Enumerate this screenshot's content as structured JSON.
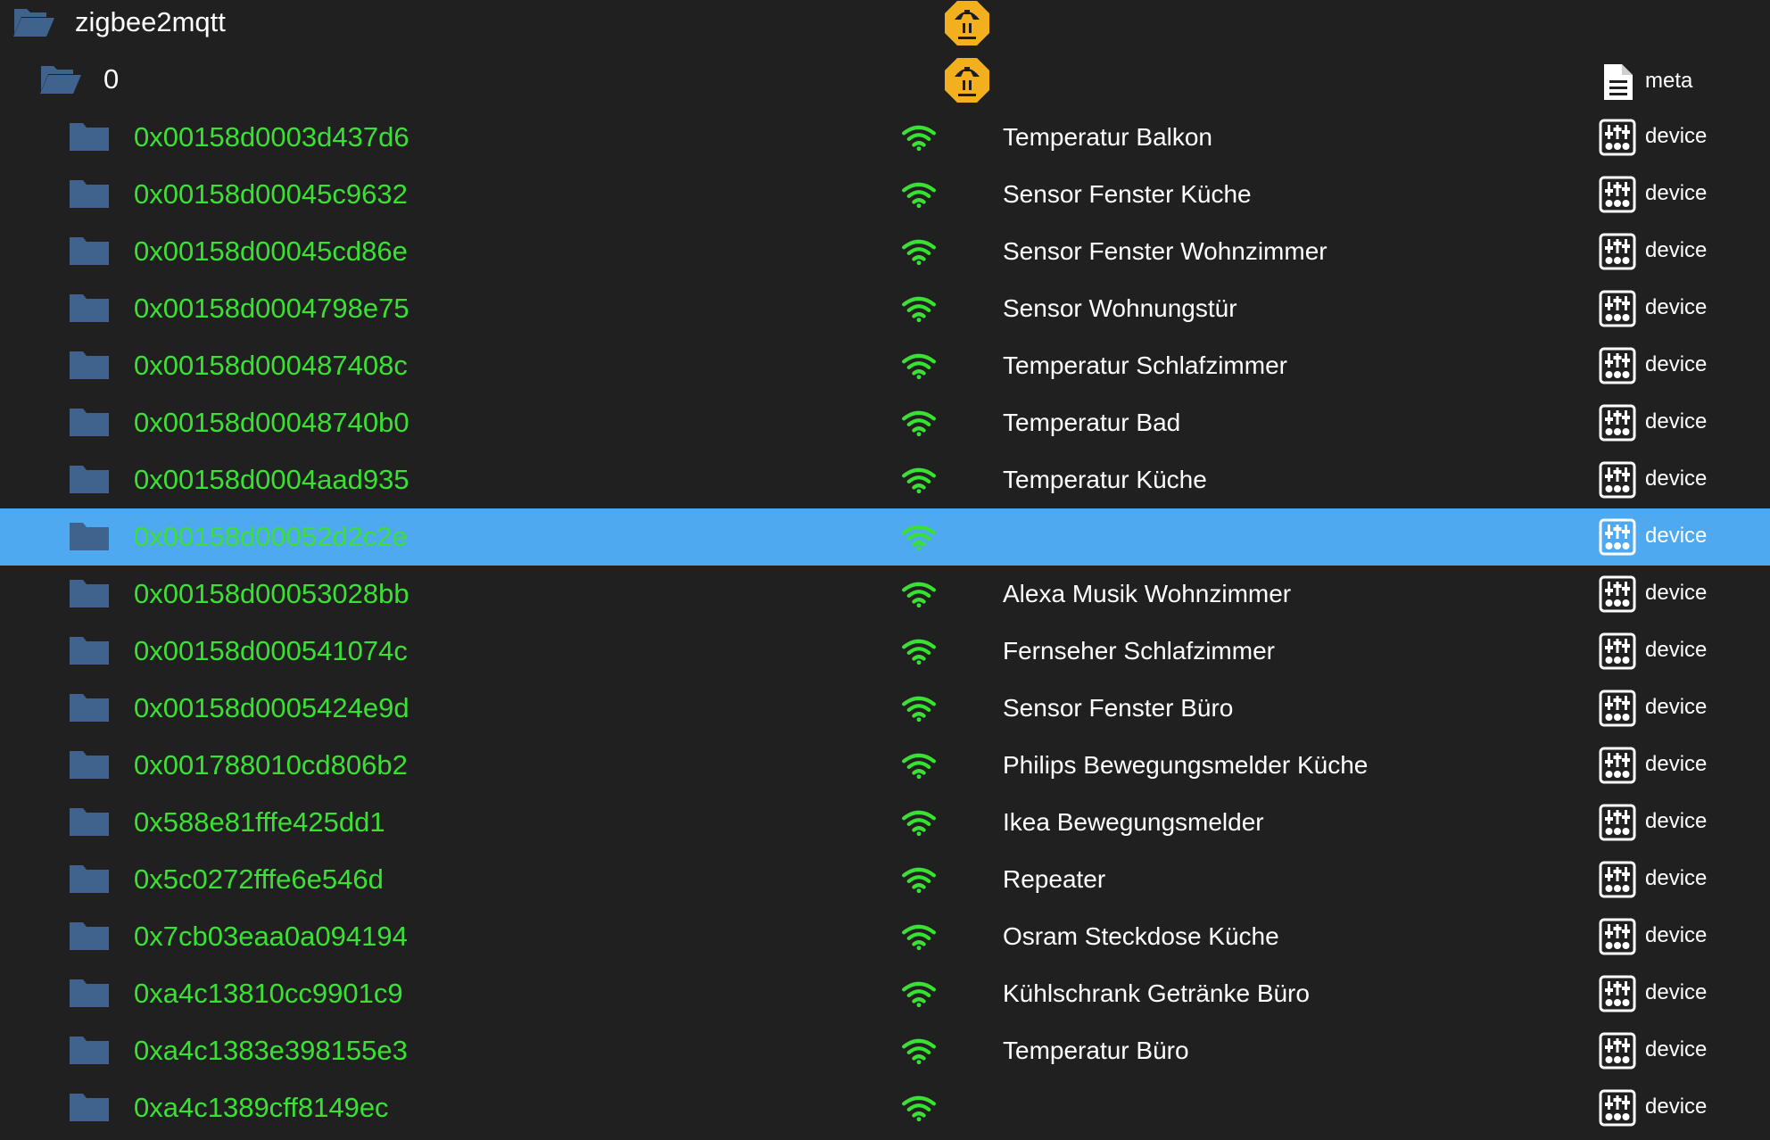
{
  "tree": {
    "root": {
      "name": "zigbee2mqtt",
      "folder_icon": "folder-open-icon",
      "adapter_icon": "mqtt-icon"
    },
    "instance": {
      "name": "0",
      "folder_icon": "folder-open-icon",
      "adapter_icon": "mqtt-icon",
      "type": "meta",
      "type_icon": "file-document-icon"
    },
    "devices": [
      {
        "id": "0x00158d0003d437d6",
        "title": "Temperatur Balkon",
        "type": "device"
      },
      {
        "id": "0x00158d00045c9632",
        "title": "Sensor Fenster Küche",
        "type": "device"
      },
      {
        "id": "0x00158d00045cd86e",
        "title": "Sensor Fenster Wohnzimmer",
        "type": "device"
      },
      {
        "id": "0x00158d0004798e75",
        "title": "Sensor Wohnungstür",
        "type": "device"
      },
      {
        "id": "0x00158d000487408c",
        "title": "Temperatur Schlafzimmer",
        "type": "device"
      },
      {
        "id": "0x00158d00048740b0",
        "title": "Temperatur Bad",
        "type": "device"
      },
      {
        "id": "0x00158d0004aad935",
        "title": "Temperatur Küche",
        "type": "device"
      },
      {
        "id": "0x00158d00052d2c2e",
        "title": "",
        "type": "device",
        "selected": true
      },
      {
        "id": "0x00158d00053028bb",
        "title": "Alexa Musik Wohnzimmer",
        "type": "device"
      },
      {
        "id": "0x00158d000541074c",
        "title": "Fernseher Schlafzimmer",
        "type": "device"
      },
      {
        "id": "0x00158d0005424e9d",
        "title": "Sensor Fenster Büro",
        "type": "device"
      },
      {
        "id": "0x001788010cd806b2",
        "title": "Philips Bewegungsmelder Küche",
        "type": "device"
      },
      {
        "id": "0x588e81fffe425dd1",
        "title": "Ikea Bewegungsmelder",
        "type": "device"
      },
      {
        "id": "0x5c0272fffe6e546d",
        "title": "Repeater",
        "type": "device"
      },
      {
        "id": "0x7cb03eaa0a094194",
        "title": "Osram Steckdose Küche",
        "type": "device"
      },
      {
        "id": "0xa4c13810cc9901c9",
        "title": "Kühlschrank Getränke Büro",
        "type": "device"
      },
      {
        "id": "0xa4c1383e398155e3",
        "title": "Temperatur Büro",
        "type": "device"
      },
      {
        "id": "0xa4c1389cff8149ec",
        "title": "",
        "type": "device"
      }
    ],
    "device_folder_icon": "folder-icon",
    "device_status_icon": "wifi-icon",
    "device_type_icon": "device-icon"
  },
  "colors": {
    "background": "#202020",
    "selected_row": "#4fa9f1",
    "device_id_text": "#3be035",
    "wifi_green": "#3be035",
    "folder_blue": "#40638e",
    "mqtt_yellow": "#f2b01e"
  }
}
